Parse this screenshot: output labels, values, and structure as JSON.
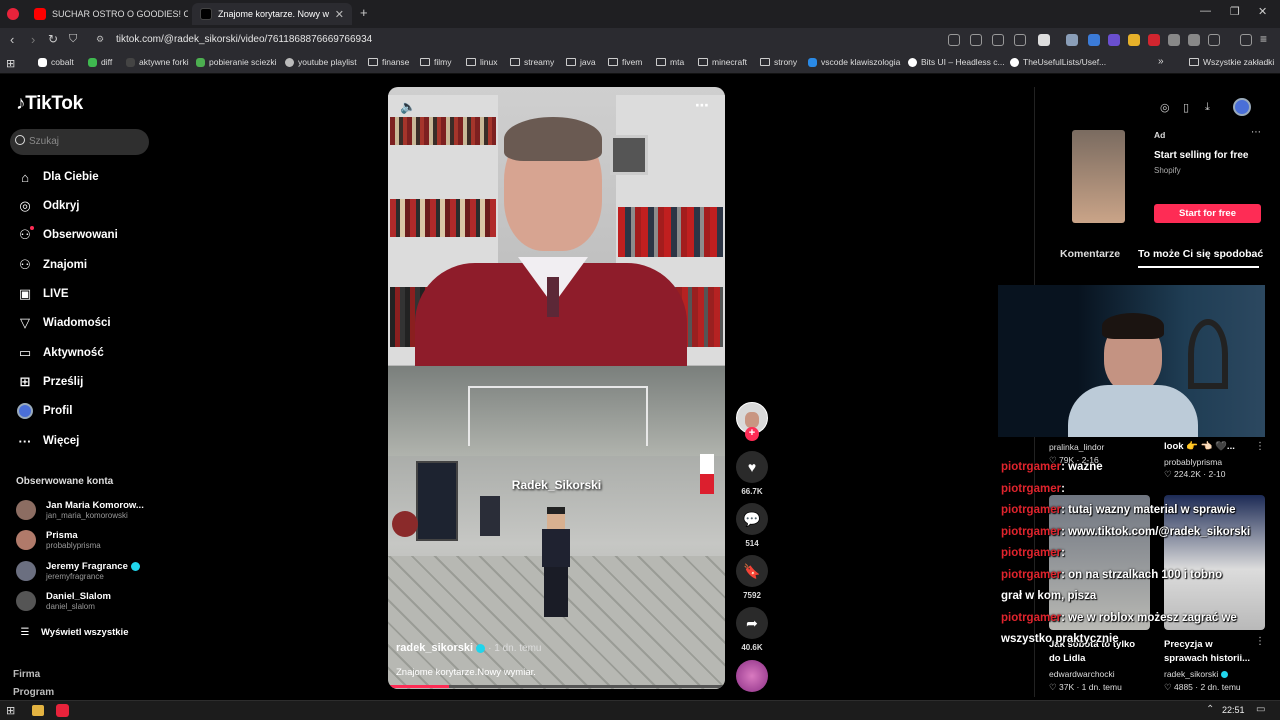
{
  "browser": {
    "tabs": [
      {
        "title": "SUCHAR OSTRO O GOODIES! ODPO..."
      },
      {
        "title": "Znajome korytarze. Nowy wymia..."
      }
    ],
    "url": "tiktok.com/@radek_sikorski/video/7611868876669766934",
    "bookmarks": [
      "cobalt",
      "diff",
      "aktywne forki",
      "pobieranie sciezki",
      "youtube playlist",
      "finanse",
      "filmy",
      "linux",
      "streamy",
      "java",
      "fivem",
      "mta",
      "minecraft",
      "strony",
      "vscode klawiszologia",
      "Bits UI – Headless c...",
      "TheUsefulLists/Usef..."
    ],
    "all_bookmarks": "Wszystkie zakładki"
  },
  "sidebar": {
    "logo": "TikTok",
    "search_placeholder": "Szukaj",
    "menu": [
      {
        "label": "Dla Ciebie",
        "icon": "home-icon"
      },
      {
        "label": "Odkryj",
        "icon": "compass-icon"
      },
      {
        "label": "Obserwowani",
        "icon": "following-icon"
      },
      {
        "label": "Znajomi",
        "icon": "friends-icon"
      },
      {
        "label": "LIVE",
        "icon": "live-icon"
      },
      {
        "label": "Wiadomości",
        "icon": "messages-icon"
      },
      {
        "label": "Aktywność",
        "icon": "activity-icon"
      },
      {
        "label": "Prześlij",
        "icon": "upload-icon"
      },
      {
        "label": "Profil",
        "icon": "profile-icon"
      },
      {
        "label": "Więcej",
        "icon": "more-icon"
      }
    ],
    "followed_title": "Obserwowane konta",
    "followed": [
      {
        "name": "Jan Maria Komorow...",
        "handle": "jan_maria_komorowski"
      },
      {
        "name": "Prisma",
        "handle": "probablyprisma"
      },
      {
        "name": "Jeremy Fragrance",
        "handle": "jeremyfragrance",
        "verified": true
      },
      {
        "name": "Daniel_Slalom",
        "handle": "daniel_slalom"
      }
    ],
    "show_all": "Wyświetl wszystkie",
    "footer": [
      "Firma",
      "Program"
    ]
  },
  "video": {
    "author": "radek_sikorski",
    "age": "· 1 dn. temu",
    "caption": "Znajome korytarze.Nowy wymiar.",
    "game_nametag": "Radek_Sikorski",
    "progress": 0.18
  },
  "actions": {
    "likes": "66.7K",
    "comments": "514",
    "saves": "7592",
    "shares": "40.6K"
  },
  "right": {
    "ad_label": "Ad",
    "ad_title": "Start selling for free",
    "ad_brand": "Shopify",
    "ad_button": "Start for free",
    "tab_comments": "Komentarze",
    "tab_suggested": "To może Ci się spodobać",
    "cards": [
      {
        "author": "pralinka_lindor",
        "likes": "79K",
        "date": "2-16"
      },
      {
        "title": "look 👉 👈🏻 🖤...",
        "author": "probablyprisma",
        "likes": "224.2K",
        "date": "2-10"
      },
      {
        "title": "Jak sobota to tylko do Lidla",
        "author": "edwardwarchocki",
        "likes": "37K",
        "date": "1 dn. temu"
      },
      {
        "title": "Precyzja w sprawach historii...",
        "author": "radek_sikorski",
        "likes": "4885",
        "date": "2 dn. temu"
      }
    ]
  },
  "chat": [
    {
      "user": "piotrgamer",
      "text": ": wazne"
    },
    {
      "user": "piotrgamer",
      "text": ":"
    },
    {
      "user": "piotrgamer",
      "text": ": tutaj wazny material w sprawie"
    },
    {
      "user": "piotrgamer",
      "text": ": www.tiktok.com/@radek_sikorski"
    },
    {
      "user": "piotrgamer",
      "text": ":"
    },
    {
      "user": "piotrgamer",
      "text": ": on na strzalkach 100 i tobno"
    },
    {
      "user": "",
      "text": "grał w kom, pisza"
    },
    {
      "user": "piotrgamer",
      "text": ": we w roblox możesz zagrać we"
    },
    {
      "user": "",
      "text": "wszystko praktycznie"
    }
  ],
  "taskbar": {
    "time": "22:51"
  }
}
